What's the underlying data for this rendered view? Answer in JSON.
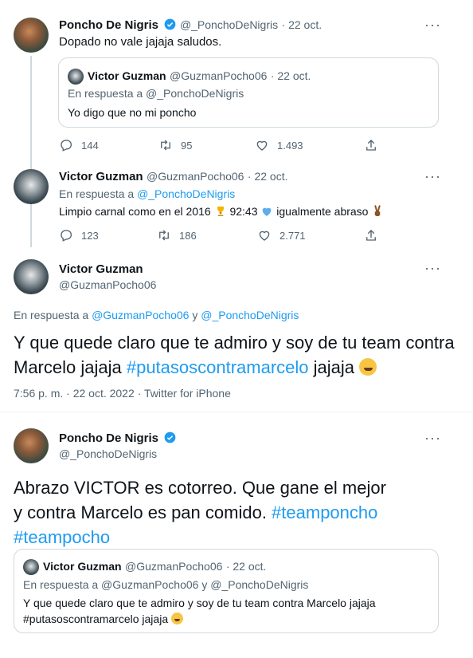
{
  "tweet1": {
    "author_name": "Poncho De Nigris",
    "author_handle": "@_PonchoDeNigris",
    "date": "· 22 oct.",
    "text": "Dopado no vale jajaja saludos.",
    "quote": {
      "author_name": "Victor Guzman",
      "author_handle": "@GuzmanPocho06",
      "date": "· 22 oct.",
      "reply_to": "En respuesta a @_PonchoDeNigris",
      "text": "Yo digo que no mi poncho"
    },
    "replies": "144",
    "retweets": "95",
    "likes": "1.493"
  },
  "tweet2": {
    "author_name": "Victor Guzman",
    "author_handle": "@GuzmanPocho06",
    "date": "· 22 oct.",
    "reply_prefix": "En respuesta a ",
    "reply_handle": "@_PonchoDeNigris",
    "text_a": "Limpio carnal como en el 2016 ",
    "text_b": " 92:43 ",
    "text_c": " igualmente abraso ",
    "replies": "123",
    "retweets": "186",
    "likes": "2.771"
  },
  "tweet3": {
    "author_name": "Victor Guzman",
    "author_handle": "@GuzmanPocho06",
    "reply_prefix": "En respuesta a ",
    "reply_handle_1": "@GuzmanPocho06",
    "reply_join": " y ",
    "reply_handle_2": "@_PonchoDeNigris",
    "text_a": "Y que quede claro que te admiro y soy de tu team contra Marcelo jajaja ",
    "hashtag": "#putasoscontramarcelo",
    "text_b": " jajaja ",
    "timestamp": "7:56 p. m. · 22 oct. 2022 · Twitter for iPhone"
  },
  "tweet4": {
    "author_name": "Poncho De Nigris",
    "author_handle": "@_PonchoDeNigris",
    "text_a": "Abrazo VICTOR es cotorreo. Que gane el mejor y contra Marcelo es pan comido. ",
    "hashtag_1": "#teamponcho",
    "hashtag_2": "#teampocho",
    "quote": {
      "author_name": "Victor Guzman",
      "author_handle": "@GuzmanPocho06",
      "date": "· 22 oct.",
      "reply_to": "En respuesta a @GuzmanPocho06 y @_PonchoDeNigris",
      "text_1": "Y que quede claro que te admiro y soy de tu team contra Marcelo jajaja",
      "text_2": "#putasoscontramarcelo jajaja "
    }
  },
  "more_label": "···",
  "colors": {
    "link": "#1d9bf0",
    "muted": "#536471",
    "border": "#cfd9de",
    "verified": "#1d9bf0"
  }
}
